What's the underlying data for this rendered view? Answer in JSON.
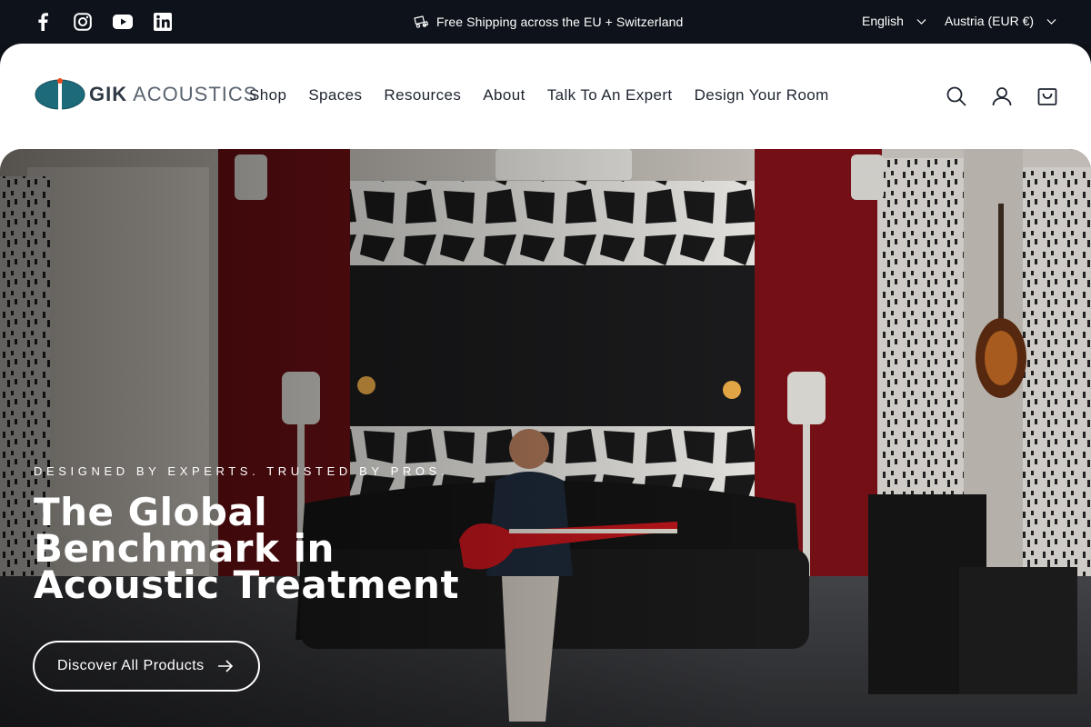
{
  "topbar": {
    "social_icons": [
      "facebook-icon",
      "instagram-icon",
      "youtube-icon",
      "linkedin-icon"
    ],
    "announcement_icon": "truck-icon",
    "announcement": "Free Shipping across the EU + Switzerland",
    "language": "English",
    "country": "Austria (EUR €)"
  },
  "header": {
    "logo": {
      "brand": "GIK",
      "suffix": "ACOUSTICS"
    },
    "nav": [
      "Shop",
      "Spaces",
      "Resources",
      "About",
      "Talk To An Expert",
      "Design Your Room"
    ],
    "icons": [
      "search-icon",
      "account-icon",
      "cart-icon"
    ]
  },
  "hero": {
    "eyebrow": "DESIGNED BY EXPERTS. TRUSTED BY PROS.",
    "headline_lines": [
      "The Global",
      "Benchmark in",
      "Acoustic Treatment"
    ],
    "cta_label": "Discover All Products",
    "cta_icon": "arrow-right-icon"
  },
  "colors": {
    "topbar_bg": "#0e131b",
    "header_bg": "#ffffff",
    "logo_teal": "#1d6b7a",
    "logo_accent": "#e84a1c",
    "hero_red_wall": "#7a1116"
  }
}
